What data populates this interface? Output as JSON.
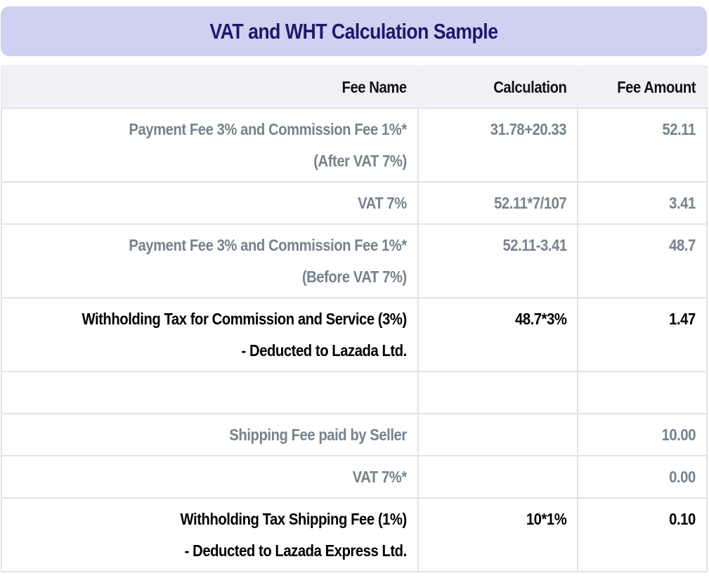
{
  "title": "VAT and WHT Calculation Sample",
  "table": {
    "headers": {
      "fee_name": "Fee Name",
      "calculation": "Calculation",
      "fee_amount": "Fee Amount"
    },
    "rows": [
      {
        "style": "muted",
        "fee_name_line1": "Payment Fee 3% and Commission Fee 1%*",
        "fee_name_line2": "(After VAT 7%)",
        "calculation": "31.78+20.33",
        "fee_amount": "52.11"
      },
      {
        "style": "muted",
        "fee_name_line1": "VAT 7%",
        "fee_name_line2": "",
        "calculation": "52.11*7/107",
        "fee_amount": "3.41"
      },
      {
        "style": "muted",
        "fee_name_line1": "Payment Fee 3% and Commission Fee 1%*",
        "fee_name_line2": "(Before VAT 7%)",
        "calculation": "52.11-3.41",
        "fee_amount": "48.7"
      },
      {
        "style": "strong",
        "fee_name_line1": "Withholding Tax for Commission and Service (3%)",
        "fee_name_line2": "- Deducted to Lazada Ltd.",
        "calculation": "48.7*3%",
        "fee_amount": "1.47"
      },
      {
        "style": "empty",
        "fee_name_line1": "",
        "fee_name_line2": "",
        "calculation": "",
        "fee_amount": ""
      },
      {
        "style": "muted",
        "fee_name_line1": "Shipping Fee paid by Seller",
        "fee_name_line2": "",
        "calculation": "",
        "fee_amount": "10.00"
      },
      {
        "style": "muted",
        "fee_name_line1": "VAT 7%*",
        "fee_name_line2": "",
        "calculation": "",
        "fee_amount": "0.00"
      },
      {
        "style": "strong",
        "fee_name_line1": "Withholding Tax Shipping Fee (1%)",
        "fee_name_line2": "- Deducted to Lazada Express Ltd.",
        "calculation": "10*1%",
        "fee_amount": "0.10"
      }
    ]
  },
  "colors": {
    "title_background": "#cfd1f0",
    "title_text": "#1b1a6b",
    "header_background": "#f0f1f6",
    "muted_text": "#77828c",
    "strong_text": "#000000",
    "grid_border": "#e1e3e6"
  }
}
